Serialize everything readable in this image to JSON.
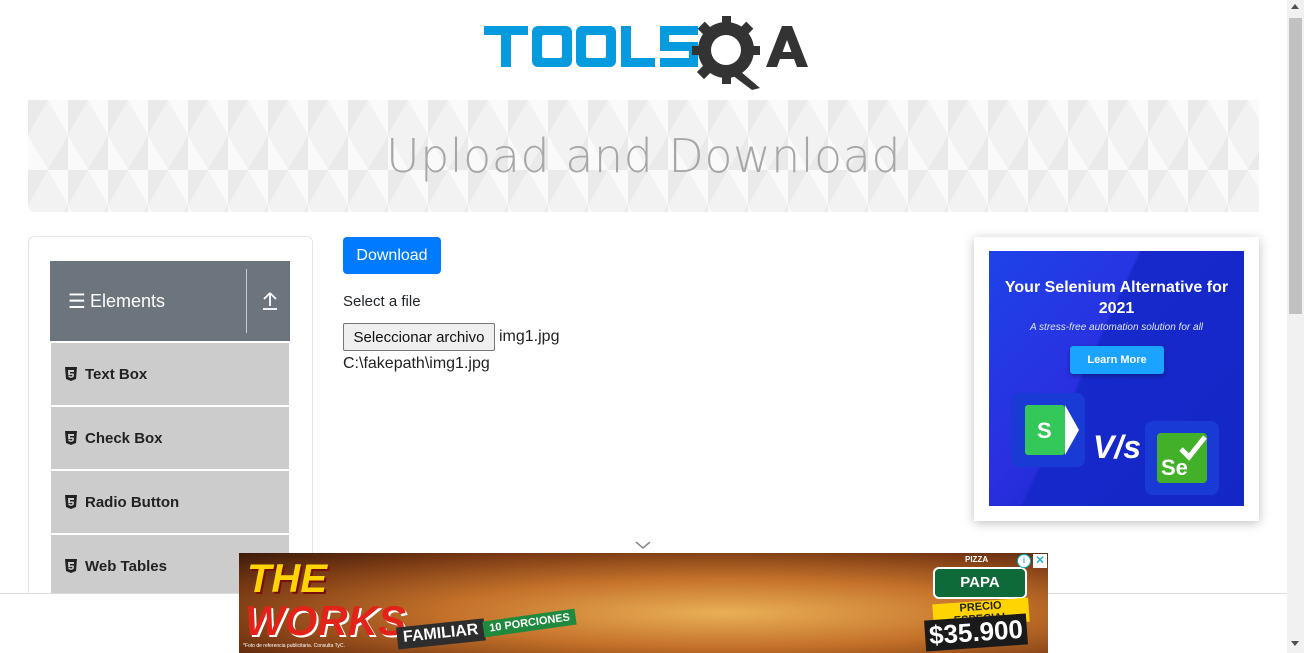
{
  "header": {
    "logo_text_left": "TOOLS",
    "logo_text_right": "QA",
    "logo_colors": {
      "tools": "#069bde",
      "qa": "#333333"
    }
  },
  "banner": {
    "title": "Upload and Download"
  },
  "sidebar": {
    "group_title": "Elements",
    "group_icon": "hamburger-icon",
    "collapse_icon": "upload-arrow-icon",
    "items": [
      {
        "label": "Text Box",
        "icon": "html5-icon"
      },
      {
        "label": "Check Box",
        "icon": "html5-icon"
      },
      {
        "label": "Radio Button",
        "icon": "html5-icon"
      },
      {
        "label": "Web Tables",
        "icon": "html5-icon"
      }
    ]
  },
  "main": {
    "download_label": "Download",
    "select_label": "Select a file",
    "file_button_label": "Seleccionar archivo",
    "file_name": "img1.jpg",
    "uploaded_path": "C:\\fakepath\\img1.jpg"
  },
  "ad_right": {
    "title": "Your Selenium Alternative for 2021",
    "subtitle": "A stress-free automation solution for all",
    "cta": "Learn More",
    "vs_text": "V/s",
    "logo_left": "S",
    "logo_right": "Se"
  },
  "ad_bottom": {
    "line1": "THE",
    "line2": "WORKS",
    "familiar": "FAMILIAR",
    "porciones": "10 PORCIONES",
    "brand": "PAPA JOHN'S",
    "brand_small": "PIZZA",
    "promo": "PRECIO ESPECIAL",
    "price": "$35.900",
    "fine_print": "*Foto de referencia publicitaria. Consulta TyC.",
    "info_label": "i",
    "close_label": "✕"
  },
  "colors": {
    "primary": "#007bff",
    "sidebar_header": "#6c757d",
    "sidebar_item": "#cccccc",
    "banner_text": "#a7a7a7"
  }
}
